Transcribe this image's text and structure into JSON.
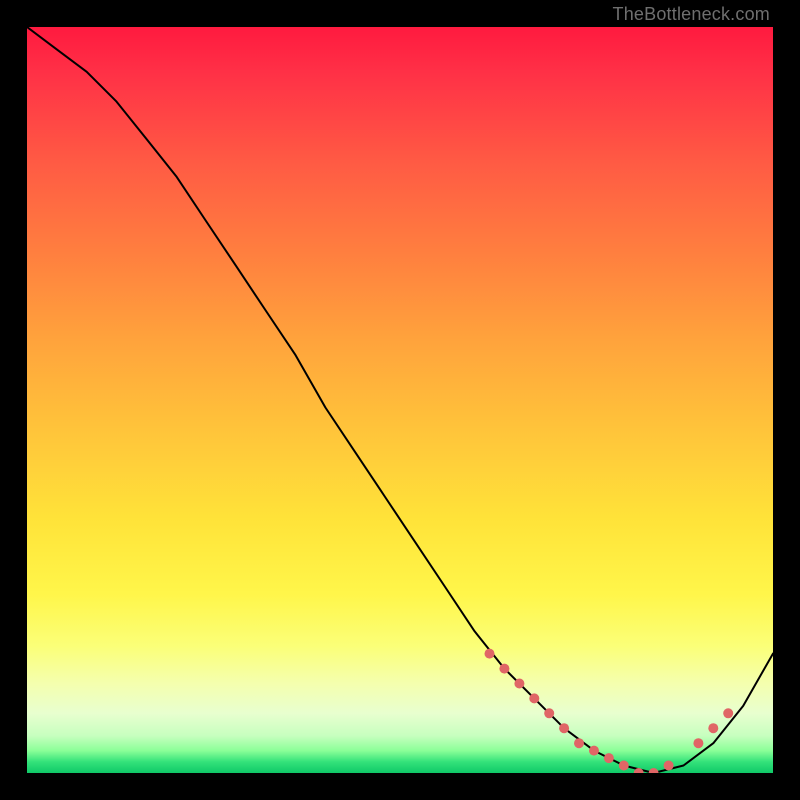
{
  "watermark": "TheBottleneck.com",
  "chart_data": {
    "type": "line",
    "title": "",
    "xlabel": "",
    "ylabel": "",
    "xlim": [
      0,
      100
    ],
    "ylim": [
      0,
      100
    ],
    "series": [
      {
        "name": "curve",
        "x": [
          0,
          4,
          8,
          12,
          16,
          20,
          24,
          28,
          32,
          36,
          40,
          44,
          48,
          52,
          56,
          60,
          64,
          68,
          72,
          76,
          80,
          84,
          88,
          92,
          96,
          100
        ],
        "y": [
          100,
          97,
          94,
          90,
          85,
          80,
          74,
          68,
          62,
          56,
          49,
          43,
          37,
          31,
          25,
          19,
          14,
          10,
          6,
          3,
          1,
          0,
          1,
          4,
          9,
          16
        ]
      }
    ],
    "markers": {
      "name": "highlight-dots",
      "x": [
        62,
        64,
        66,
        68,
        70,
        72,
        74,
        76,
        78,
        80,
        82,
        84,
        86,
        90,
        92,
        94
      ],
      "y": [
        16,
        14,
        12,
        10,
        8,
        6,
        4,
        3,
        2,
        1,
        0,
        0,
        1,
        4,
        6,
        8
      ]
    },
    "background": {
      "gradient_stops": [
        {
          "pct": 0,
          "color": "#ff1a3f"
        },
        {
          "pct": 30,
          "color": "#ff7e3f"
        },
        {
          "pct": 66,
          "color": "#ffe339"
        },
        {
          "pct": 92,
          "color": "#e8ffcf"
        },
        {
          "pct": 100,
          "color": "#0fc968"
        }
      ]
    }
  }
}
